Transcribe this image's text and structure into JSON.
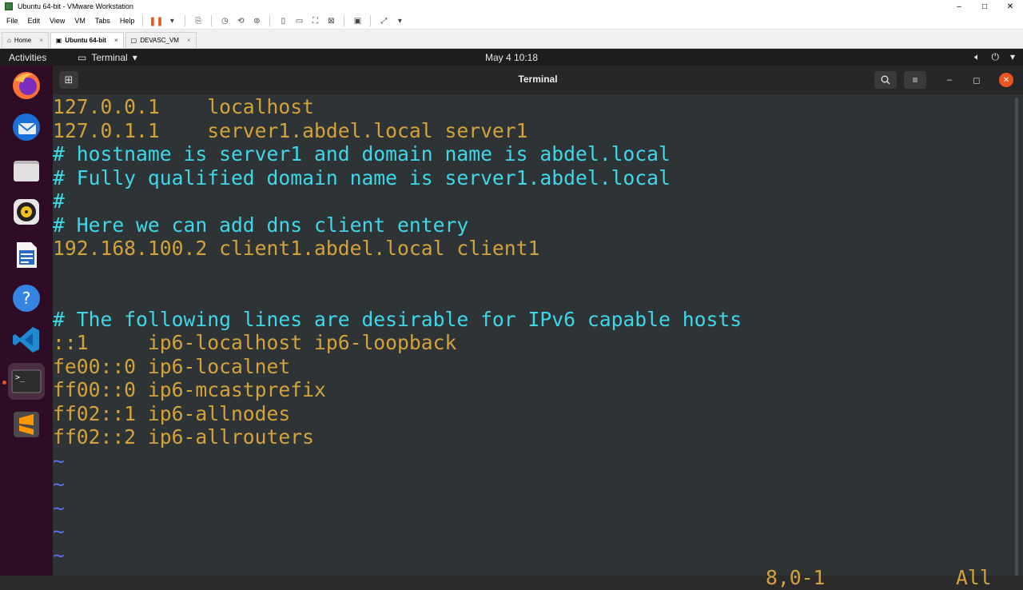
{
  "vmware": {
    "title": "Ubuntu 64-bit - VMware Workstation",
    "menus": [
      "File",
      "Edit",
      "View",
      "VM",
      "Tabs",
      "Help"
    ],
    "tabs": [
      {
        "label": "Home",
        "active": false
      },
      {
        "label": "Ubuntu 64-bit",
        "active": true
      },
      {
        "label": "DEVASC_VM",
        "active": false
      }
    ]
  },
  "topbar": {
    "activities": "Activities",
    "app_menu": "Terminal",
    "clock": "May 4  10:18"
  },
  "dock": {
    "items": [
      "firefox-icon",
      "thunderbird-icon",
      "files-icon",
      "rhythmbox-icon",
      "libreoffice-writer-icon",
      "help-icon",
      "vscode-icon",
      "terminal-icon",
      "sublime-text-icon"
    ],
    "active": "terminal-icon"
  },
  "terminal": {
    "title": "Terminal",
    "lines": [
      {
        "text": "127.0.0.1    localhost",
        "kind": "hosts"
      },
      {
        "text": "127.0.1.1    server1.abdel.local server1",
        "kind": "hosts"
      },
      {
        "text": "# hostname is server1 and domain name is abdel.local",
        "kind": "comment"
      },
      {
        "text": "# Fully qualified domain name is server1.abdel.local",
        "kind": "comment"
      },
      {
        "text": "#",
        "kind": "comment"
      },
      {
        "text": "# Here we can add dns client entery",
        "kind": "comment"
      },
      {
        "text": "192.168.100.2 client1.abdel.local client1",
        "kind": "hosts"
      },
      {
        "text": "",
        "kind": "hosts"
      },
      {
        "text": "",
        "kind": "hosts"
      },
      {
        "text": "# The following lines are desirable for IPv6 capable hosts",
        "kind": "comment"
      },
      {
        "text": "::1     ip6-localhost ip6-loopback",
        "kind": "hosts"
      },
      {
        "text": "fe00::0 ip6-localnet",
        "kind": "hosts"
      },
      {
        "text": "ff00::0 ip6-mcastprefix",
        "kind": "hosts"
      },
      {
        "text": "ff02::1 ip6-allnodes",
        "kind": "hosts"
      },
      {
        "text": "ff02::2 ip6-allrouters",
        "kind": "hosts"
      },
      {
        "text": "~",
        "kind": "tilde"
      },
      {
        "text": "~",
        "kind": "tilde"
      },
      {
        "text": "~",
        "kind": "tilde"
      },
      {
        "text": "~",
        "kind": "tilde"
      },
      {
        "text": "~",
        "kind": "tilde"
      }
    ],
    "status_position": "8,0-1",
    "status_scroll": "All"
  },
  "colors": {
    "hosts_text": "#d4a23a",
    "comment_text": "#3fd7e8",
    "tilde": "#5a6ef0",
    "terminal_bg": "#2e3436",
    "dock_bg": "#2f0c25",
    "accent": "#e95420"
  }
}
